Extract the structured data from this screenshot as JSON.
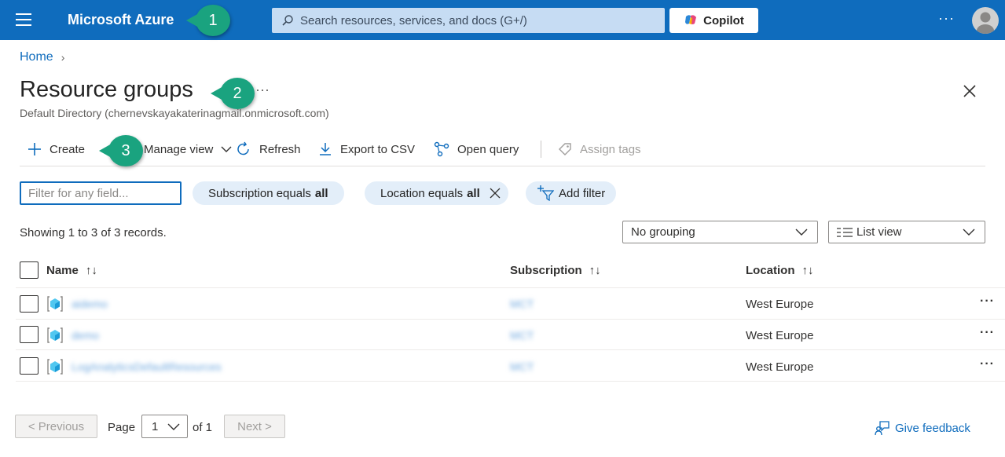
{
  "topbar": {
    "brand": "Microsoft Azure",
    "search_placeholder": "Search resources, services, and docs (G+/)",
    "copilot_label": "Copilot",
    "more": "···"
  },
  "callouts": [
    "1",
    "2",
    "3"
  ],
  "breadcrumb": {
    "home": "Home",
    "chevron": "›"
  },
  "page": {
    "title": "Resource groups",
    "title_more": "···",
    "subtitle": "Default Directory (chernevskayakaterinagmail.onmicrosoft.com)"
  },
  "toolbar": {
    "create": "Create",
    "manage_view": "Manage view",
    "refresh": "Refresh",
    "export_csv": "Export to CSV",
    "open_query": "Open query",
    "assign_tags": "Assign tags"
  },
  "filters": {
    "placeholder": "Filter for any field...",
    "subscription_prefix": "Subscription equals",
    "subscription_value": "all",
    "location_prefix": "Location equals",
    "location_value": "all",
    "add_filter": "Add filter"
  },
  "records_text": "Showing 1 to 3 of 3 records.",
  "grouping": "No grouping",
  "view": "List view",
  "table": {
    "columns": {
      "name": "Name",
      "subscription": "Subscription",
      "location": "Location"
    },
    "sort_name": "↑↓",
    "sort_sub": "↑↓",
    "sort_loc": "↑↓",
    "rows": [
      {
        "name": "aidemo",
        "subscription": "MCT",
        "location": "West Europe",
        "more": "···"
      },
      {
        "name": "demo",
        "subscription": "MCT",
        "location": "West Europe",
        "more": "···"
      },
      {
        "name": "LogAnalyticsDefaultResources",
        "subscription": "MCT",
        "location": "West Europe",
        "more": "···"
      }
    ]
  },
  "pagination": {
    "previous": "< Previous",
    "page_label": "Page",
    "page_value": "1",
    "of_label": "of 1",
    "next": "Next >"
  },
  "feedback": "Give feedback",
  "colors": {
    "topbar": "#0f6cbd",
    "accent": "#0f6cbd",
    "callout": "#1aa37f",
    "pill": "#e3eef9"
  }
}
